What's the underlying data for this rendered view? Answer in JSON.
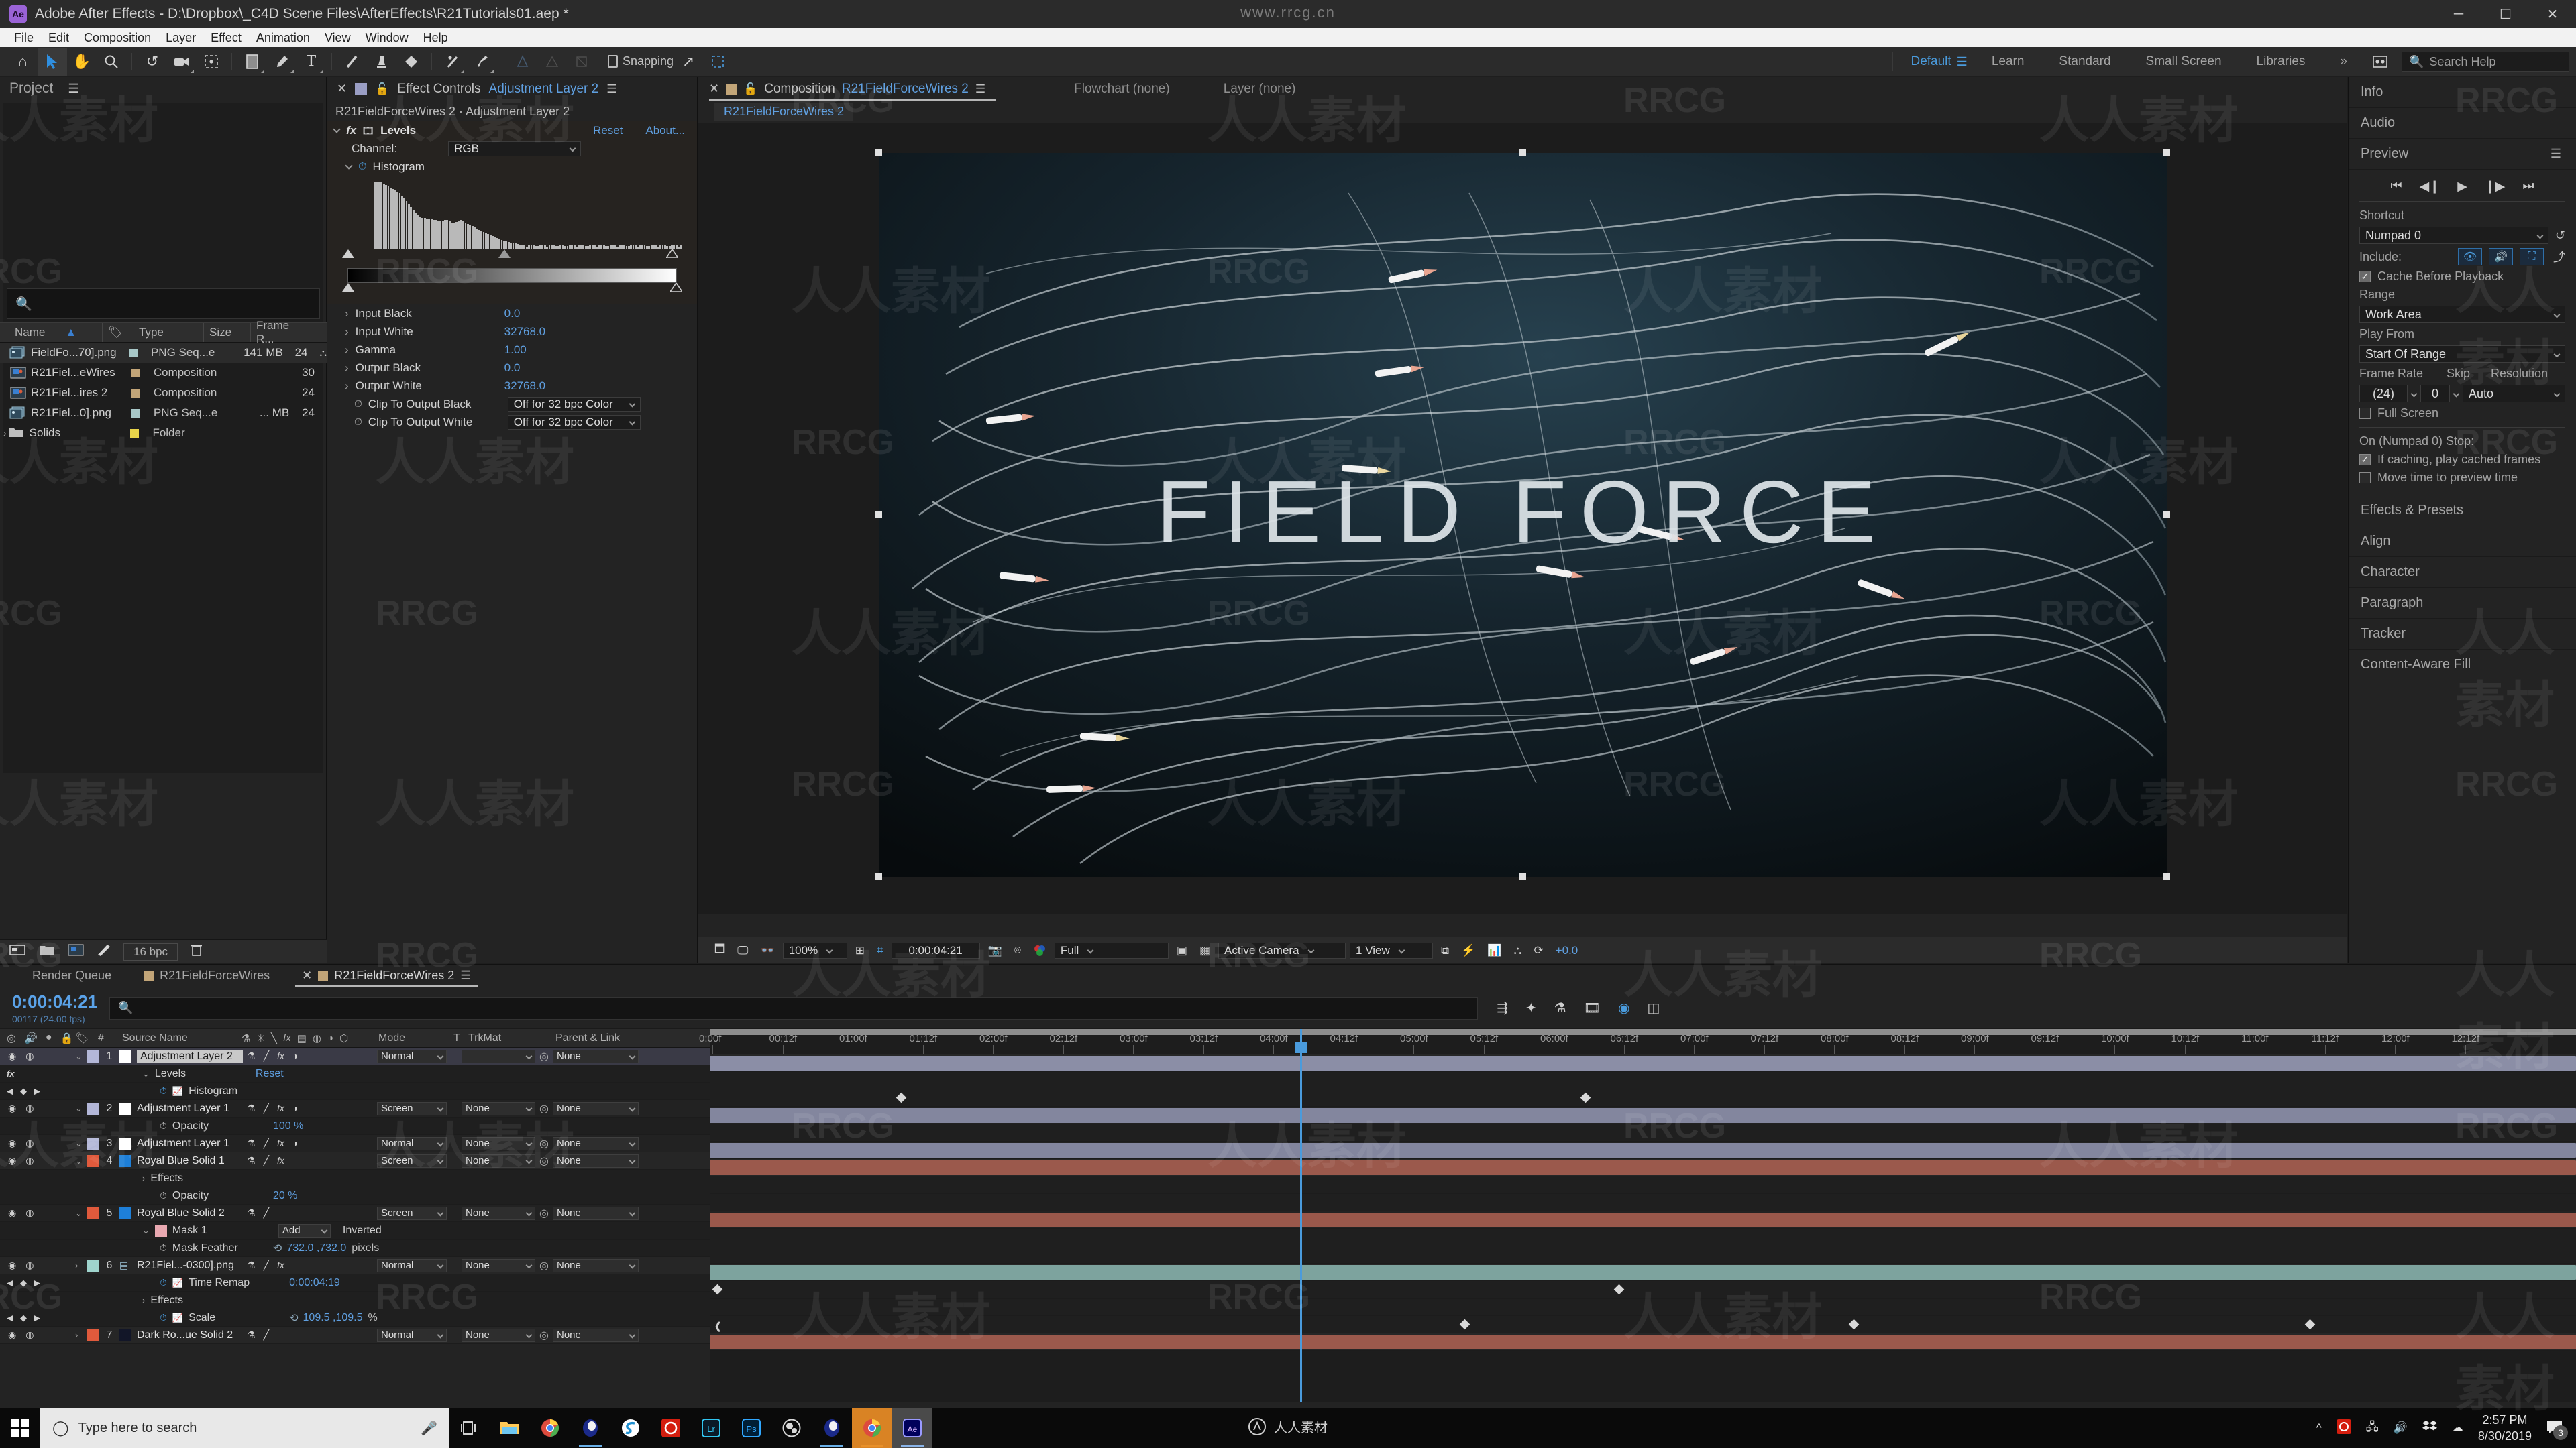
{
  "window": {
    "app_name": "Adobe After Effects",
    "title": "Adobe After Effects - D:\\Dropbox\\_C4D Scene Files\\AfterEffects\\R21Tutorials01.aep *",
    "logo_text": "Ae",
    "minimize": "─",
    "maximize": "☐",
    "close": "✕",
    "watermark_top": "www.rrcg.cn"
  },
  "menu": [
    "File",
    "Edit",
    "Composition",
    "Layer",
    "Effect",
    "Animation",
    "View",
    "Window",
    "Help"
  ],
  "toolbar": {
    "snapping_label": "Snapping",
    "tools": [
      {
        "name": "home-icon"
      },
      {
        "name": "selection-tool-icon"
      },
      {
        "name": "hand-tool-icon"
      },
      {
        "name": "zoom-tool-icon"
      },
      {
        "name": "rotation-tool-icon"
      },
      {
        "name": "camera-tool-icon"
      },
      {
        "name": "pan-behind-tool-icon"
      },
      {
        "name": "shape-tool-icon"
      },
      {
        "name": "pen-tool-icon"
      },
      {
        "name": "type-tool-icon"
      },
      {
        "name": "brush-tool-icon"
      },
      {
        "name": "clone-stamp-tool-icon"
      },
      {
        "name": "eraser-tool-icon"
      },
      {
        "name": "roto-brush-tool-icon"
      },
      {
        "name": "puppet-pin-tool-icon"
      }
    ]
  },
  "workspaces": {
    "items": [
      "Default",
      "Learn",
      "Standard",
      "Small Screen",
      "Libraries"
    ],
    "selected": "Default",
    "overflow": "»",
    "search_help_placeholder": "Search Help"
  },
  "project": {
    "title": "Project",
    "search_placeholder": "",
    "columns": [
      "Name",
      "Type",
      "Size",
      "Frame R..."
    ],
    "sort_column": "Name",
    "items": [
      {
        "name": "FieldFo...70].png",
        "type": "PNG Seq...e",
        "size": "141 MB",
        "fps": "24",
        "label_color": "#a8c8c8",
        "icon": "png-sequence-icon",
        "has_link": true
      },
      {
        "name": "R21Fiel...eWires",
        "type": "Composition",
        "size": "",
        "fps": "30",
        "label_color": "#c2a578",
        "icon": "composition-icon",
        "has_link": false
      },
      {
        "name": "R21Fiel...ires 2",
        "type": "Composition",
        "size": "",
        "fps": "24",
        "label_color": "#c2a578",
        "icon": "composition-icon",
        "has_link": false
      },
      {
        "name": "R21Fiel...0].png",
        "type": "PNG Seq...e",
        "size": "... MB",
        "fps": "24",
        "label_color": "#a8c8c8",
        "icon": "png-sequence-icon",
        "has_link": false
      },
      {
        "name": "Solids",
        "type": "Folder",
        "size": "",
        "fps": "",
        "label_color": "#e8d44a",
        "icon": "folder-icon",
        "has_link": false
      }
    ],
    "footer": {
      "bit_depth": "16 bpc"
    }
  },
  "effect_controls": {
    "tab_label": "Effect Controls",
    "tab_target": "Adjustment Layer 2",
    "subtitle": "R21FieldForceWires 2 · Adjustment Layer 2",
    "effect_name": "Levels",
    "reset_label": "Reset",
    "about_label": "About...",
    "channel_label": "Channel:",
    "channel_value": "RGB",
    "histogram_label": "Histogram",
    "params": [
      {
        "label": "Input Black",
        "value": "0.0"
      },
      {
        "label": "Input White",
        "value": "32768.0"
      },
      {
        "label": "Gamma",
        "value": "1.00"
      },
      {
        "label": "Output Black",
        "value": "0.0"
      },
      {
        "label": "Output White",
        "value": "32768.0"
      }
    ],
    "dropdown_params": [
      {
        "label": "Clip To Output Black",
        "value": "Off for 32 bpc Color"
      },
      {
        "label": "Clip To Output White",
        "value": "Off for 32 bpc Color"
      }
    ]
  },
  "composition": {
    "tabs": [
      {
        "label": "Composition",
        "name_value": "R21FieldForceWires 2",
        "selected": true
      },
      {
        "label": "Flowchart (none)",
        "name_value": "",
        "selected": false
      },
      {
        "label": "Layer (none)",
        "name_value": "",
        "selected": false
      }
    ],
    "breadcrumb": "R21FieldForceWires 2",
    "render_title": "FIELD FORCE",
    "bottom_bar": {
      "magnification": "100%",
      "timecode": "0:00:04:21",
      "resolution": "Full",
      "view_camera": "Active Camera",
      "views": "1 View",
      "exposure": "+0.0"
    }
  },
  "right_sidebar": {
    "panels": [
      "Info",
      "Audio",
      "Preview"
    ],
    "preview": {
      "title": "Preview",
      "transport": [
        "first-frame",
        "prev-frame",
        "play",
        "next-frame",
        "last-frame"
      ],
      "shortcut_label": "Shortcut",
      "shortcut_value": "Numpad 0",
      "include_label": "Include:",
      "include_toggles": [
        "video-icon",
        "audio-icon",
        "layer-controls-icon"
      ],
      "cache_before_playback": {
        "label": "Cache Before Playback",
        "checked": true
      },
      "range_label": "Range",
      "range_value": "Work Area",
      "play_from_label": "Play From",
      "play_from_value": "Start Of Range",
      "frame_rate_label": "Frame Rate",
      "frame_rate_value": "(24)",
      "skip_label": "Skip",
      "skip_value": "0",
      "resolution_label": "Resolution",
      "resolution_value": "Auto",
      "full_screen": {
        "label": "Full Screen",
        "checked": false
      },
      "on_stop_label": "On (Numpad 0) Stop:",
      "if_caching": {
        "label": "If caching, play cached frames",
        "checked": true
      },
      "move_time": {
        "label": "Move time to preview time",
        "checked": false
      }
    },
    "collapsed_panels": [
      "Effects & Presets",
      "Align",
      "Character",
      "Paragraph",
      "Tracker",
      "Content-Aware Fill"
    ]
  },
  "timeline": {
    "tabs": [
      {
        "label": "Render Queue",
        "swatch": false,
        "selected": false
      },
      {
        "label": "R21FieldForceWires",
        "swatch": true,
        "selected": false
      },
      {
        "label": "R21FieldForceWires 2",
        "swatch": true,
        "selected": true
      }
    ],
    "current_time": "0:00:04:21",
    "current_frame": "00117 (24.00 fps)",
    "search_placeholder": "",
    "columns": [
      "#",
      "Source Name",
      "Mode",
      "T",
      "TrkMat",
      "Parent & Link"
    ],
    "ruler_ticks": [
      "0:00f",
      "00:12f",
      "01:00f",
      "01:12f",
      "02:00f",
      "02:12f",
      "03:00f",
      "03:12f",
      "04:00f",
      "04:12f",
      "05:00f",
      "05:12f",
      "06:00f",
      "06:12f",
      "07:00f",
      "07:12f",
      "08:00f",
      "08:12f",
      "09:00f",
      "09:12f",
      "10:00f",
      "10:12f",
      "11:00f",
      "11:12f",
      "12:00f",
      "12:12f"
    ],
    "layers": [
      {
        "index": "1",
        "name": "Adjustment Layer 2",
        "label_color": "#b3b7d8",
        "source_swatch": "#ffffff",
        "mode": "Normal",
        "trkmat": "",
        "parent": "None",
        "bar_color": "#b3b7d8",
        "selected": true,
        "has_fx": true
      },
      {
        "index": "",
        "name": "Levels",
        "kind": "effect-group",
        "value": "Reset",
        "indent": 2
      },
      {
        "index": "",
        "name": "Histogram",
        "kind": "property",
        "value": "",
        "indent": 3,
        "keyframe_nav": true
      },
      {
        "index": "2",
        "name": "Adjustment Layer 1",
        "label_color": "#b3b7d8",
        "source_swatch": "#ffffff",
        "mode": "Screen",
        "trkmat": "None",
        "parent": "None",
        "bar_color": "#a9adcf",
        "has_fx": true
      },
      {
        "index": "",
        "name": "Opacity",
        "kind": "property",
        "value": "100 %",
        "indent": 3
      },
      {
        "index": "3",
        "name": "Adjustment Layer 1",
        "label_color": "#b3b7d8",
        "source_swatch": "#ffffff",
        "mode": "Normal",
        "trkmat": "None",
        "parent": "None",
        "bar_color": "#a9adcf",
        "has_fx": true
      },
      {
        "index": "4",
        "name": "Royal Blue Solid 1",
        "label_color": "#e05a3c",
        "source_swatch": "#1e7fd8",
        "mode": "Screen",
        "trkmat": "None",
        "parent": "None",
        "bar_color": "#c96d5c",
        "has_fx": true
      },
      {
        "index": "",
        "name": "Effects",
        "kind": "group",
        "value": "",
        "indent": 2
      },
      {
        "index": "",
        "name": "Opacity",
        "kind": "property",
        "value": "20 %",
        "indent": 3
      },
      {
        "index": "5",
        "name": "Royal Blue Solid 2",
        "label_color": "#e05a3c",
        "source_swatch": "#1e7fd8",
        "mode": "Screen",
        "trkmat": "None",
        "parent": "None",
        "bar_color": "#c96d5c",
        "has_fx": false
      },
      {
        "index": "",
        "name": "Mask 1",
        "kind": "mask",
        "mask_mode": "Add",
        "mask_inverted": "Inverted",
        "indent": 2,
        "mask_swatch": "#e8a8b0"
      },
      {
        "index": "",
        "name": "Mask Feather",
        "kind": "property",
        "value": "732.0 ,732.0",
        "unit": "pixels",
        "indent": 3,
        "linked": true
      },
      {
        "index": "6",
        "name": "R21Fiel...-0300].png",
        "label_color": "#9fd4cd",
        "source_swatch": "",
        "mode": "Normal",
        "trkmat": "None",
        "parent": "None",
        "bar_color": "#9fd4cd",
        "has_fx": true
      },
      {
        "index": "",
        "name": "Time Remap",
        "kind": "property",
        "value": "0:00:04:19",
        "indent": 3,
        "keyframe_nav": true
      },
      {
        "index": "",
        "name": "Effects",
        "kind": "group",
        "value": "",
        "indent": 2
      },
      {
        "index": "",
        "name": "Scale",
        "kind": "property",
        "value": "109.5 ,109.5",
        "unit": "%",
        "indent": 3,
        "keyframe_nav": true,
        "linked": true
      },
      {
        "index": "7",
        "name": "Dark Ro...ue Solid 2",
        "label_color": "#e05a3c",
        "source_swatch": "#121628",
        "mode": "Normal",
        "trkmat": "None",
        "parent": "None",
        "bar_color": "#c96d5c",
        "has_fx": false
      }
    ]
  },
  "taskbar": {
    "search_placeholder": "Type here to search",
    "apps": [
      "task-view-icon",
      "file-explorer-icon",
      "chrome-icon",
      "cinema4d-icon",
      "sketchup-icon",
      "creative-cloud-icon",
      "lightroom-icon",
      "photoshop-icon",
      "obs-icon",
      "cinema4d-2-icon",
      "chrome-active-icon",
      "after-effects-icon"
    ],
    "watermark": "人人素材",
    "time": "2:57 PM",
    "date": "8/30/2019",
    "notification_count": "3"
  },
  "watermarks": {
    "text_cn": "人人素材",
    "text_en": "RRCG"
  },
  "colors": {
    "accent_blue": "#4a9bdc",
    "panel_bg": "#232323",
    "dark_bg": "#1c1c1c",
    "label_orange": "#e05a3c",
    "label_tan": "#c2a578"
  }
}
